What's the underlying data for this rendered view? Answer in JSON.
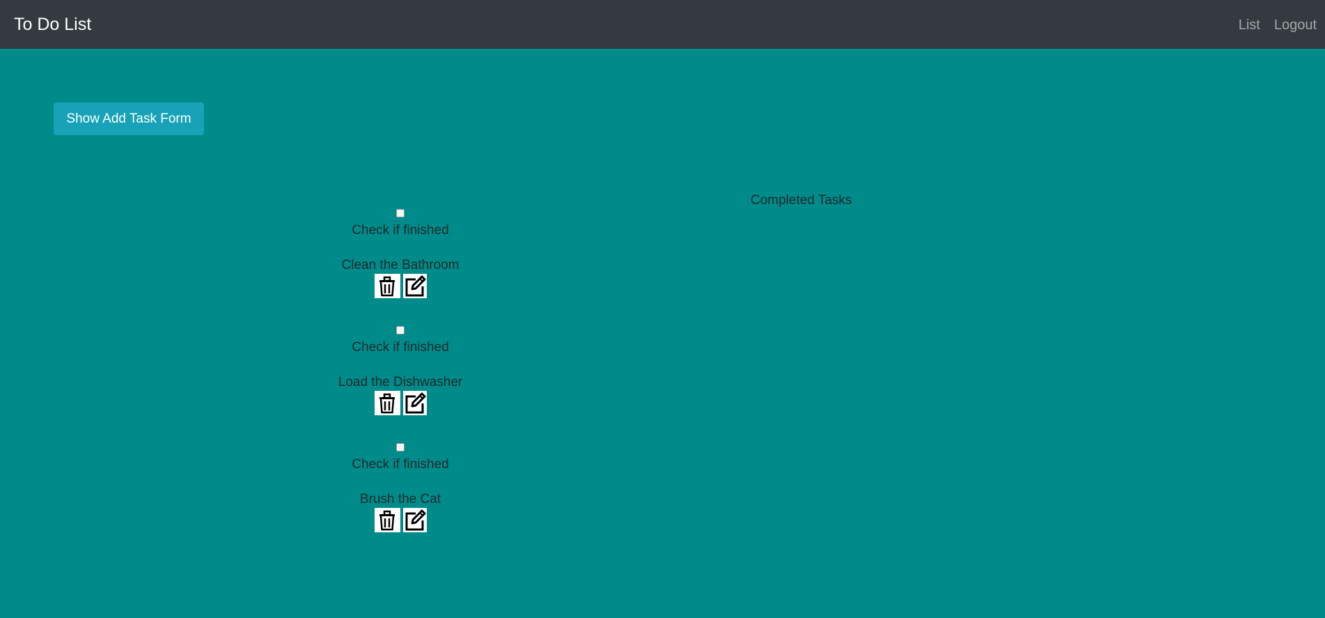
{
  "navbar": {
    "brand": "To Do List",
    "links": [
      "List",
      "Logout"
    ]
  },
  "actions": {
    "show_add_task_label": "Show Add Task Form"
  },
  "tasks": [
    {
      "check_label": "Check if finished",
      "name": "Clean the Bathroom",
      "finished": false
    },
    {
      "check_label": "Check if finished",
      "name": "Load the Dishwasher",
      "finished": false
    },
    {
      "check_label": "Check if finished",
      "name": "Brush the Cat",
      "finished": false
    }
  ],
  "completed": {
    "heading": "Completed Tasks"
  },
  "icons": {
    "delete": "trash-icon",
    "edit": "edit-icon"
  },
  "colors": {
    "background": "#008b8b",
    "navbar": "#343a40",
    "button": "#17a2b8"
  }
}
